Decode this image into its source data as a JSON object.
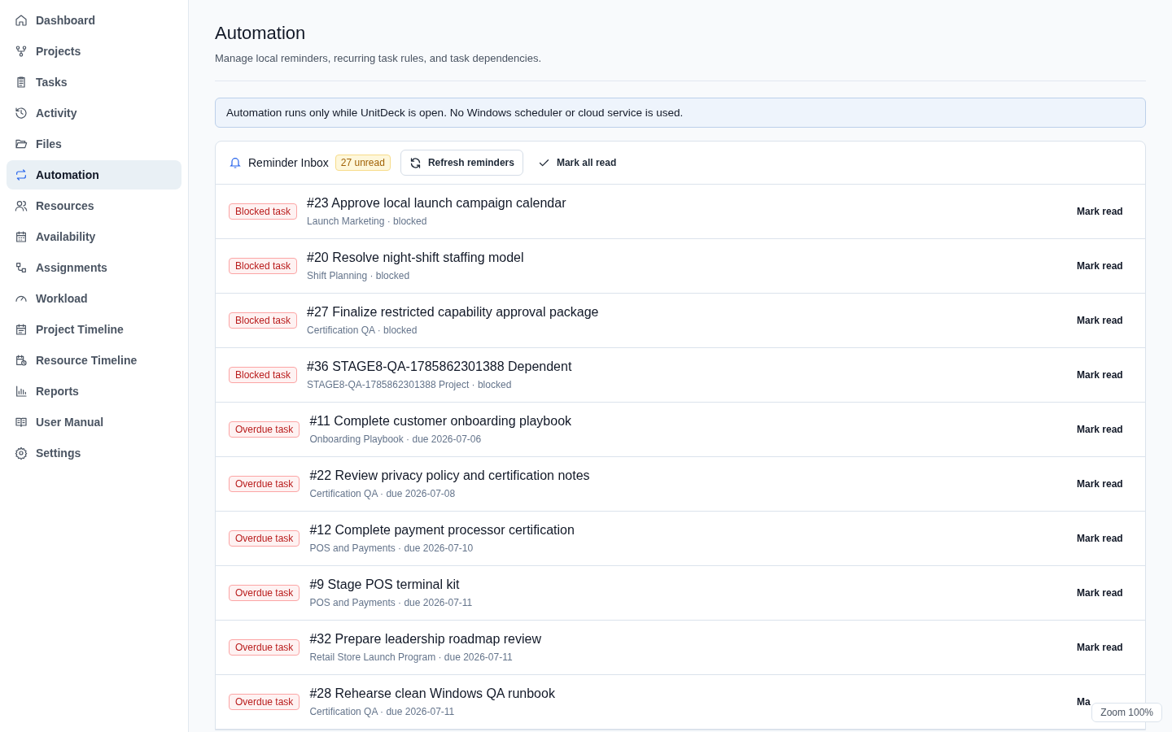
{
  "sidebar": {
    "items": [
      {
        "label": "Dashboard",
        "selected": false
      },
      {
        "label": "Projects",
        "selected": false
      },
      {
        "label": "Tasks",
        "selected": false
      },
      {
        "label": "Activity",
        "selected": false
      },
      {
        "label": "Files",
        "selected": false
      },
      {
        "label": "Automation",
        "selected": true
      },
      {
        "label": "Resources",
        "selected": false
      },
      {
        "label": "Availability",
        "selected": false
      },
      {
        "label": "Assignments",
        "selected": false
      },
      {
        "label": "Workload",
        "selected": false
      },
      {
        "label": "Project Timeline",
        "selected": false
      },
      {
        "label": "Resource Timeline",
        "selected": false
      },
      {
        "label": "Reports",
        "selected": false
      },
      {
        "label": "User Manual",
        "selected": false
      },
      {
        "label": "Settings",
        "selected": false
      }
    ]
  },
  "page": {
    "title": "Automation",
    "subtitle": "Manage local reminders, recurring task rules, and task dependencies."
  },
  "notice": "Automation runs only while UnitDeck is open. No Windows scheduler or cloud service is used.",
  "inbox": {
    "title": "Reminder Inbox",
    "unread": "27 unread",
    "refresh": "Refresh reminders",
    "mark_all": "Mark all read",
    "rows": [
      {
        "badge": "Blocked task",
        "title": "#23 Approve local launch campaign calendar",
        "meta": "Launch Marketing · blocked",
        "action": "Mark read"
      },
      {
        "badge": "Blocked task",
        "title": "#20 Resolve night-shift staffing model",
        "meta": "Shift Planning · blocked",
        "action": "Mark read"
      },
      {
        "badge": "Blocked task",
        "title": "#27 Finalize restricted capability approval package",
        "meta": "Certification QA · blocked",
        "action": "Mark read"
      },
      {
        "badge": "Blocked task",
        "title": "#36 STAGE8-QA-1785862301388 Dependent",
        "meta": "STAGE8-QA-1785862301388 Project · blocked",
        "action": "Mark read"
      },
      {
        "badge": "Overdue task",
        "title": "#11 Complete customer onboarding playbook",
        "meta": "Onboarding Playbook · due 2026-07-06",
        "action": "Mark read"
      },
      {
        "badge": "Overdue task",
        "title": "#22 Review privacy policy and certification notes",
        "meta": "Certification QA · due 2026-07-08",
        "action": "Mark read"
      },
      {
        "badge": "Overdue task",
        "title": "#12 Complete payment processor certification",
        "meta": "POS and Payments · due 2026-07-10",
        "action": "Mark read"
      },
      {
        "badge": "Overdue task",
        "title": "#9 Stage POS terminal kit",
        "meta": "POS and Payments · due 2026-07-11",
        "action": "Mark read"
      },
      {
        "badge": "Overdue task",
        "title": "#32 Prepare leadership roadmap review",
        "meta": "Retail Store Launch Program · due 2026-07-11",
        "action": "Mark read"
      },
      {
        "badge": "Overdue task",
        "title": "#28 Rehearse clean Windows QA runbook",
        "meta": "Certification QA · due 2026-07-11",
        "action": "Ma"
      }
    ]
  },
  "zoom": "Zoom 100%"
}
